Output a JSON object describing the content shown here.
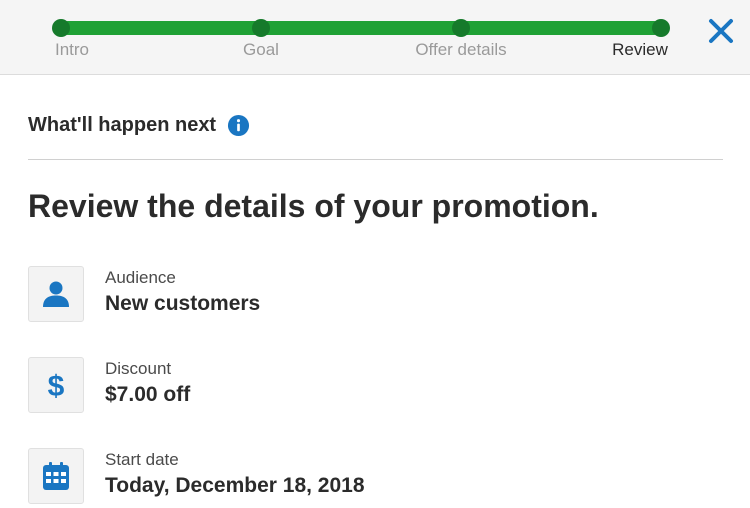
{
  "progress": {
    "steps": [
      {
        "label": "Intro"
      },
      {
        "label": "Goal"
      },
      {
        "label": "Offer details"
      },
      {
        "label": "Review"
      }
    ],
    "current_step": "Review",
    "completed_fraction": 1.0
  },
  "colors": {
    "progress_track": "#1fa135",
    "progress_dot": "#167a2b",
    "accent_blue": "#1a76c2",
    "text": "#2b2b2b"
  },
  "header": {
    "info_title": "What'll happen next",
    "info_icon": "info-icon",
    "close_icon": "close-icon"
  },
  "main": {
    "heading": "Review the details of your promotion.",
    "details": [
      {
        "label": "Audience",
        "value": "New customers",
        "icon": "person-icon"
      },
      {
        "label": "Discount",
        "value": "$7.00 off",
        "icon": "dollar-icon"
      },
      {
        "label": "Start date",
        "value": "Today, December 18, 2018",
        "icon": "calendar-icon"
      }
    ]
  }
}
